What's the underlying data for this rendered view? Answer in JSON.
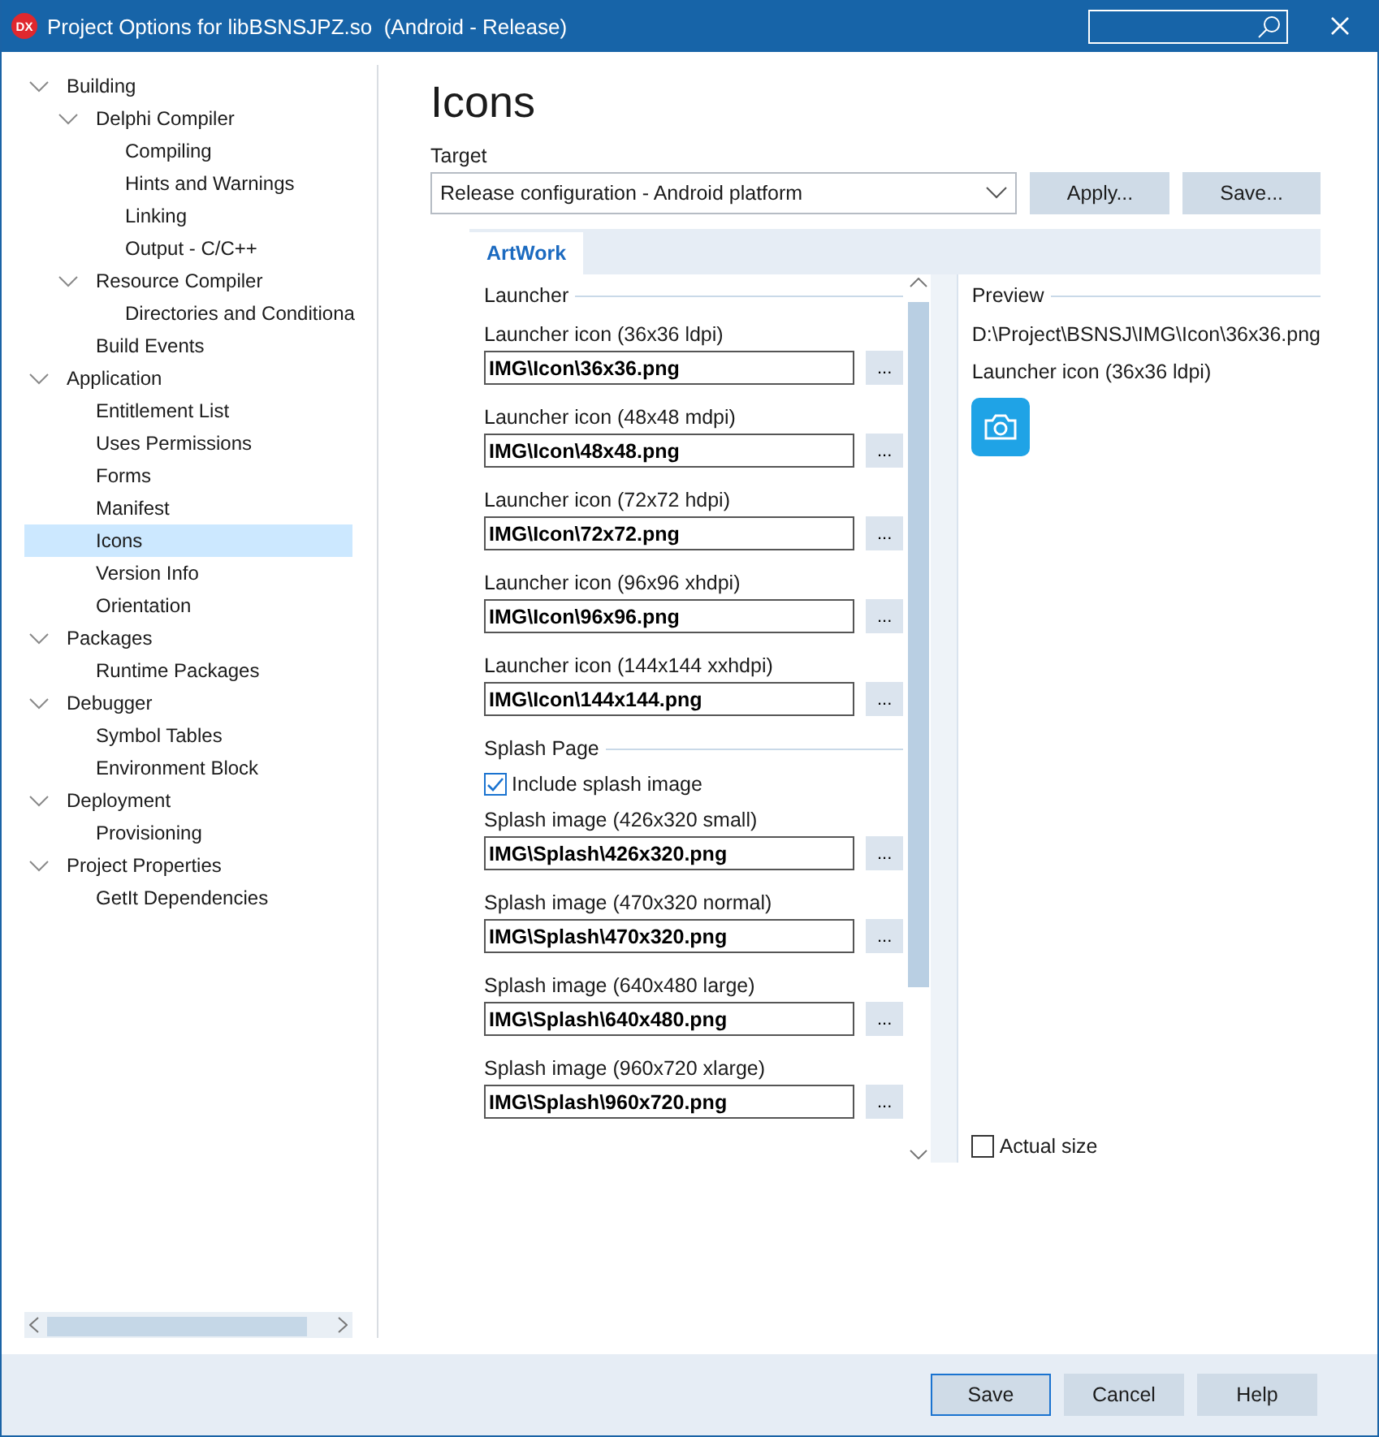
{
  "window": {
    "logo": "DX",
    "title": "Project Options for libBSNSJPZ.so  (Android - Release)"
  },
  "sidebar": {
    "items": [
      {
        "label": "Building",
        "selected": false,
        "expanded": true,
        "children": [
          {
            "label": "Delphi Compiler",
            "selected": false,
            "expanded": true,
            "children": [
              {
                "label": "Compiling",
                "selected": false
              },
              {
                "label": "Hints and Warnings",
                "selected": false
              },
              {
                "label": "Linking",
                "selected": false
              },
              {
                "label": "Output - C/C++",
                "selected": false
              }
            ]
          },
          {
            "label": "Resource Compiler",
            "selected": false,
            "expanded": true,
            "children": [
              {
                "label": "Directories and Conditiona",
                "selected": false
              }
            ]
          },
          {
            "label": "Build Events",
            "selected": false
          }
        ]
      },
      {
        "label": "Application",
        "selected": false,
        "expanded": true,
        "children": [
          {
            "label": "Entitlement List",
            "selected": false
          },
          {
            "label": "Uses Permissions",
            "selected": false
          },
          {
            "label": "Forms",
            "selected": false
          },
          {
            "label": "Manifest",
            "selected": false
          },
          {
            "label": "Icons",
            "selected": true
          },
          {
            "label": "Version Info",
            "selected": false
          },
          {
            "label": "Orientation",
            "selected": false
          }
        ]
      },
      {
        "label": "Packages",
        "selected": false,
        "expanded": true,
        "children": [
          {
            "label": "Runtime Packages",
            "selected": false
          }
        ]
      },
      {
        "label": "Debugger",
        "selected": false,
        "expanded": true,
        "children": [
          {
            "label": "Symbol Tables",
            "selected": false
          },
          {
            "label": "Environment Block",
            "selected": false
          }
        ]
      },
      {
        "label": "Deployment",
        "selected": false,
        "expanded": true,
        "children": [
          {
            "label": "Provisioning",
            "selected": false
          }
        ]
      },
      {
        "label": "Project Properties",
        "selected": false,
        "expanded": true,
        "children": [
          {
            "label": "GetIt Dependencies",
            "selected": false
          }
        ]
      }
    ]
  },
  "page": {
    "title": "Icons",
    "target_label": "Target",
    "target_value": "Release configuration - Android platform",
    "buttons": [
      "Apply...",
      "Save..."
    ]
  },
  "tabs": [
    {
      "label": "ArtWork",
      "selected": true
    }
  ],
  "sections": [
    {
      "title": "Launcher",
      "items": [
        {
          "kind": "file",
          "label": "Launcher icon (36x36 ldpi)",
          "value": "IMG\\Icon\\36x36.png",
          "button": "..."
        },
        {
          "kind": "file",
          "label": "Launcher icon (48x48 mdpi)",
          "value": "IMG\\Icon\\48x48.png",
          "button": "..."
        },
        {
          "kind": "file",
          "label": "Launcher icon (72x72 hdpi)",
          "value": "IMG\\Icon\\72x72.png",
          "button": "..."
        },
        {
          "kind": "file",
          "label": "Launcher icon (96x96 xhdpi)",
          "value": "IMG\\Icon\\96x96.png",
          "button": "..."
        },
        {
          "kind": "file",
          "label": "Launcher icon (144x144 xxhdpi)",
          "value": "IMG\\Icon\\144x144.png",
          "button": "..."
        }
      ]
    },
    {
      "title": "Splash Page",
      "items": [
        {
          "kind": "checkbox",
          "label": "Include splash image",
          "checked": true
        },
        {
          "kind": "file",
          "label": "Splash image (426x320 small)",
          "value": "IMG\\Splash\\426x320.png",
          "button": "..."
        },
        {
          "kind": "file",
          "label": "Splash image (470x320 normal)",
          "value": "IMG\\Splash\\470x320.png",
          "button": "..."
        },
        {
          "kind": "file",
          "label": "Splash image (640x480 large)",
          "value": "IMG\\Splash\\640x480.png",
          "button": "..."
        },
        {
          "kind": "file",
          "label": "Splash image (960x720 xlarge)",
          "value": "IMG\\Splash\\960x720.png",
          "button": "..."
        }
      ]
    }
  ],
  "preview": {
    "title": "Preview",
    "path": "D:\\Project\\BSNSJ\\IMG\\Icon\\36x36.png",
    "caption": "Launcher icon (36x36 ldpi)",
    "actual_size": {
      "label": "Actual size",
      "checked": false
    }
  },
  "footer": {
    "buttons": [
      {
        "label": "Save",
        "selected": true
      },
      {
        "label": "Cancel",
        "selected": false
      },
      {
        "label": "Help",
        "selected": false
      }
    ]
  }
}
